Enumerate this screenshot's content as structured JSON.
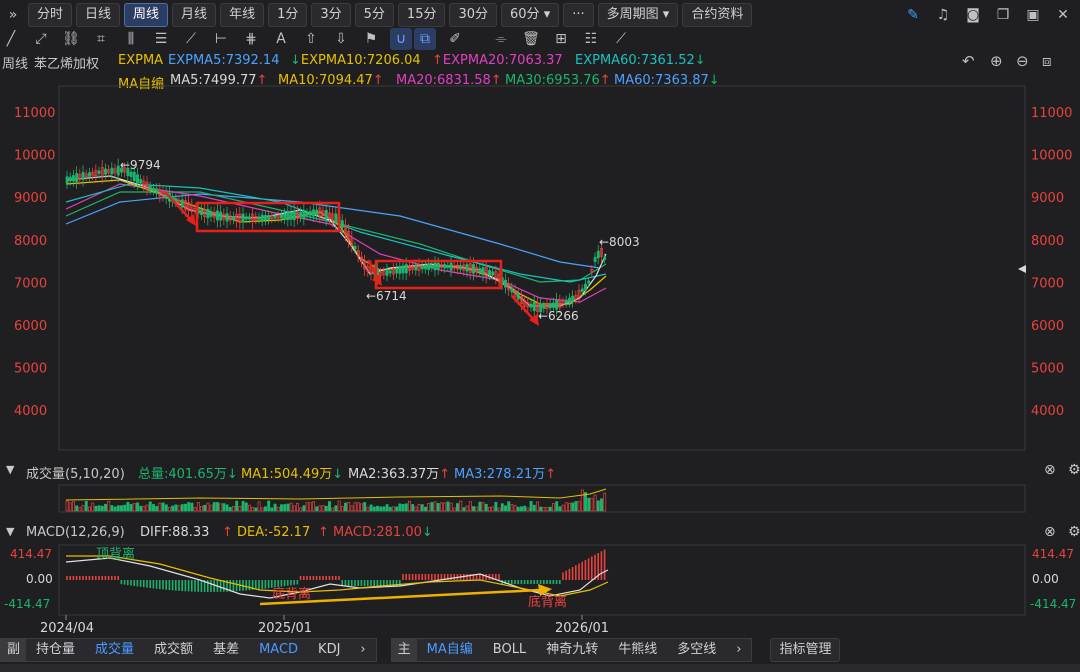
{
  "toolbar": {
    "expand_icon": "»",
    "periods": [
      "分时",
      "日线",
      "周线",
      "月线",
      "年线",
      "1分",
      "3分",
      "5分",
      "15分",
      "30分"
    ],
    "active_period": "周线",
    "period_select": "60分",
    "more": "···",
    "multi_period": "多周期图",
    "contract_info": "合约资料"
  },
  "header": {
    "period": "周线",
    "symbol": "苯乙烯加权",
    "expma_title": "EXPMA",
    "expma": [
      {
        "label": "EXPMA5:7392.14",
        "arrow": "",
        "color": "#4aa3ff"
      },
      {
        "label": "EXPMA10:7206.04",
        "arrow": "↓",
        "color": "#e6c000"
      },
      {
        "label": "EXPMA20:7063.37",
        "arrow": "↑",
        "color": "#e040c0"
      },
      {
        "label": "EXPMA60:7361.52",
        "arrow": "↓",
        "color": "#1bc0c0"
      }
    ],
    "ma_title": "MA自编",
    "ma": [
      {
        "label": "MA5:7499.77",
        "arrow": "↑",
        "color": "#d8d8d8"
      },
      {
        "label": "MA10:7094.47",
        "arrow": "↑",
        "color": "#e6c000"
      },
      {
        "label": "MA20:6831.58",
        "arrow": "↑",
        "color": "#e040c0"
      },
      {
        "label": "MA30:6953.76",
        "arrow": "↑",
        "color": "#1bb56d"
      },
      {
        "label": "MA60:7363.87",
        "arrow": "↓",
        "color": "#4aa3ff"
      }
    ]
  },
  "main_axis": {
    "ticks": [
      "11000",
      "10000",
      "9000",
      "8000",
      "7000",
      "6000",
      "5000",
      "4000"
    ]
  },
  "annotations": {
    "high1": "←9794",
    "low1": "←6714",
    "low2": "←6266",
    "high2": "←8003"
  },
  "volume": {
    "title": "成交量(5,10,20)",
    "total": "总量:401.65万",
    "total_arrow": "↓",
    "ma1": "MA1:504.49万",
    "ma1_arrow": "↓",
    "ma2": "MA2:363.37万",
    "ma2_arrow": "↑",
    "ma3": "MA3:278.21万",
    "ma3_arrow": "↑"
  },
  "macd": {
    "title": "MACD(12,26,9)",
    "diff": "DIFF:88.33",
    "diff_arrow": "↑",
    "dea": "DEA:-52.17",
    "dea_arrow": "↑",
    "macd": "MACD:281.00",
    "macd_arrow": "↓",
    "ticks": [
      "414.47",
      "0.00",
      "-414.47"
    ],
    "note_top": "顶背离",
    "note_bottom1": "底背离",
    "note_bottom2": "底背离"
  },
  "dates": [
    "2024/04",
    "2025/01",
    "2026/01"
  ],
  "bottom_tabs_left": {
    "lead": "副",
    "items": [
      "持仓量",
      "成交量",
      "成交额",
      "基差",
      "MACD",
      "KDJ"
    ],
    "active": "成交量",
    "active2": "MACD",
    "more": "›"
  },
  "bottom_tabs_right": {
    "lead": "主",
    "items": [
      "MA自编",
      "BOLL",
      "神奇九转",
      "牛熊线",
      "多空线"
    ],
    "active": "MA自编",
    "more": "›"
  },
  "indicator_manage": "指标管理",
  "chart_data": {
    "type": "line",
    "title": "苯乙烯加权",
    "x": [
      "2024/04",
      "2025/01",
      "2026/01"
    ],
    "ylim": [
      3500,
      11500
    ],
    "price_labels": {
      "high": 9794,
      "low1": 6714,
      "low2": 6266,
      "recent_high": 8003
    },
    "macd_range": [
      -414.47,
      414.47
    ]
  }
}
